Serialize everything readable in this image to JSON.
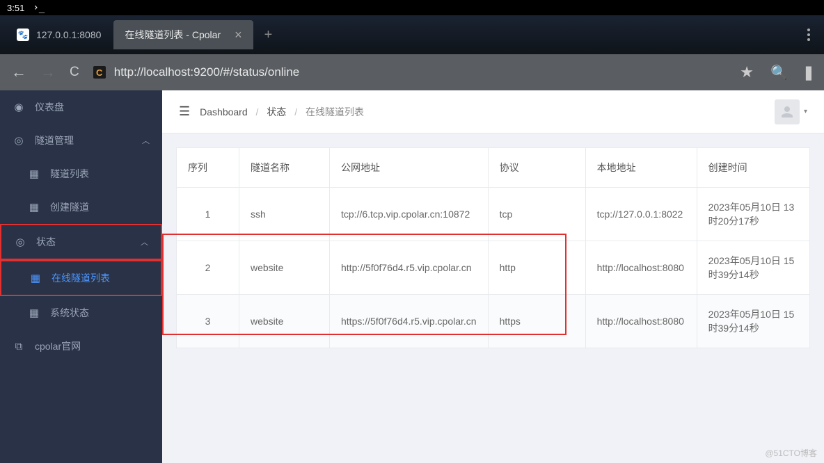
{
  "status_bar": {
    "time": "3:51",
    "prompt": "›_"
  },
  "tabs": {
    "inactive": {
      "label": "127.0.0.1:8080"
    },
    "active": {
      "label": "在线隧道列表 - Cpolar"
    }
  },
  "url": "http://localhost:9200/#/status/online",
  "url_favicon": "C",
  "sidebar": {
    "dashboard": "仪表盘",
    "tunnel_mgmt": "隧道管理",
    "tunnel_list": "隧道列表",
    "create_tunnel": "创建隧道",
    "status": "状态",
    "online_list": "在线隧道列表",
    "system_status": "系统状态",
    "official": "cpolar官网"
  },
  "breadcrumb": {
    "root": "Dashboard",
    "mid": "状态",
    "current": "在线隧道列表"
  },
  "table": {
    "headers": {
      "seq": "序列",
      "name": "隧道名称",
      "public": "公网地址",
      "protocol": "协议",
      "local": "本地地址",
      "created": "创建时间"
    },
    "rows": [
      {
        "seq": "1",
        "name": "ssh",
        "public": "tcp://6.tcp.vip.cpolar.cn:10872",
        "protocol": "tcp",
        "local": "tcp://127.0.0.1:8022",
        "created": "2023年05月10日 13时20分17秒"
      },
      {
        "seq": "2",
        "name": "website",
        "public": "http://5f0f76d4.r5.vip.cpolar.cn",
        "protocol": "http",
        "local": "http://localhost:8080",
        "created": "2023年05月10日 15时39分14秒"
      },
      {
        "seq": "3",
        "name": "website",
        "public": "https://5f0f76d4.r5.vip.cpolar.cn",
        "protocol": "https",
        "local": "http://localhost:8080",
        "created": "2023年05月10日 15时39分14秒"
      }
    ]
  },
  "watermark": "@51CTO博客"
}
